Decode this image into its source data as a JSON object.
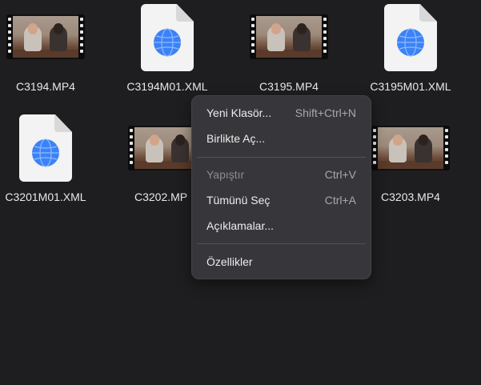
{
  "files": [
    {
      "name": "C3194.MP4",
      "kind": "video",
      "icon": "video-thumbnail"
    },
    {
      "name": "C3194M01.XML",
      "kind": "xml",
      "icon": "xml-document-icon"
    },
    {
      "name": "C3195.MP4",
      "kind": "video",
      "icon": "video-thumbnail"
    },
    {
      "name": "C3195M01.XML",
      "kind": "xml",
      "icon": "xml-document-icon"
    },
    {
      "name": "C3201M01.XML",
      "kind": "xml",
      "icon": "xml-document-icon"
    },
    {
      "name": "C3202.MP",
      "kind": "video",
      "icon": "video-thumbnail"
    },
    {
      "name": "C3203.MP4",
      "kind": "video",
      "icon": "video-thumbnail"
    }
  ],
  "context_menu": {
    "items": [
      {
        "label": "Yeni Klasör...",
        "shortcut": "Shift+Ctrl+N",
        "enabled": true
      },
      {
        "label": "Birlikte Aç...",
        "shortcut": "",
        "enabled": true
      },
      {
        "label": "Yapıştır",
        "shortcut": "Ctrl+V",
        "enabled": false
      },
      {
        "label": "Tümünü Seç",
        "shortcut": "Ctrl+A",
        "enabled": true
      },
      {
        "label": "Açıklamalar...",
        "shortcut": "",
        "enabled": true
      },
      {
        "label": "Özellikler",
        "shortcut": "",
        "enabled": true
      }
    ]
  },
  "colors": {
    "background": "#1e1e20",
    "menu_background": "#37373b",
    "text": "#e8e8ea",
    "muted": "#a8a8ac",
    "globe": "#3b82f6"
  }
}
